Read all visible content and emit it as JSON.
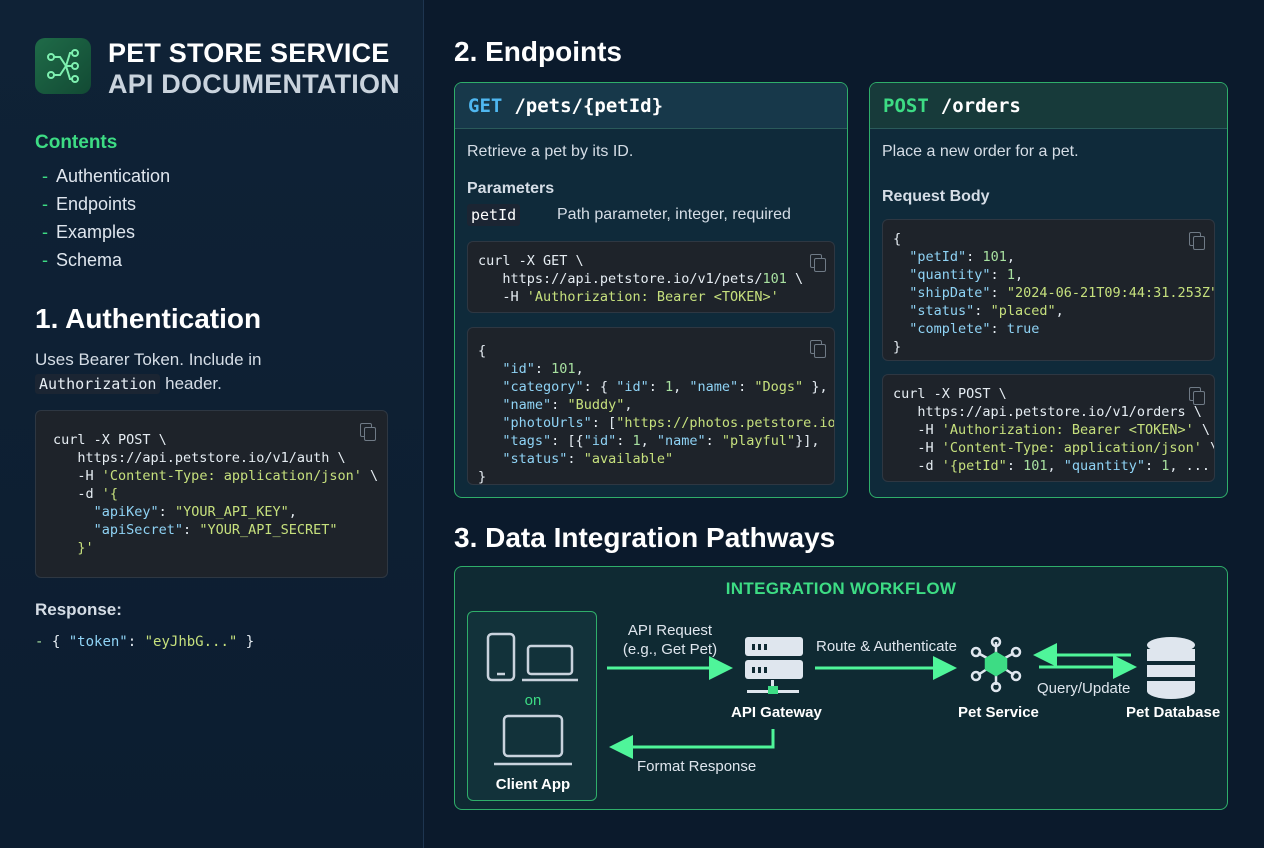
{
  "brand": {
    "title_line1": "PET STORE SERVICE",
    "title_line2": "API DOCUMENTATION",
    "logo_icon": "network-nodes-icon"
  },
  "contents": {
    "heading": "Contents",
    "items": [
      "Authentication",
      "Endpoints",
      "Examples",
      "Schema"
    ]
  },
  "auth": {
    "heading": "1. Authentication",
    "desc_prefix": "Uses Bearer Token. Include in",
    "desc_code": "Authorization",
    "desc_suffix": "header.",
    "response_heading": "Response:",
    "response_line": "- { \"token\": \"eyJhbG...\" }"
  },
  "endpoints": {
    "heading": "2. Endpoints",
    "get": {
      "method": "GET",
      "path": "/pets/{petId}",
      "desc": "Retrieve a pet by its ID.",
      "params_heading": "Parameters",
      "param_name": "petId",
      "param_desc": "Path parameter, integer, required"
    },
    "post": {
      "method": "POST",
      "path": "/orders",
      "desc": "Place a new order for a pet.",
      "body_heading": "Request Body"
    }
  },
  "integration": {
    "heading": "3. Data Integration Pathways",
    "title": "INTEGRATION WORKFLOW",
    "on": "on",
    "client_app": "Client App",
    "api_request_1": "API Request",
    "api_request_2": "(e.g., Get Pet)",
    "api_gateway": "API Gateway",
    "route_auth": "Route & Authenticate",
    "pet_service": "Pet Service",
    "query_update": "Query/Update",
    "pet_database": "Pet Database",
    "format_response": "Format Response"
  },
  "colors": {
    "accent_green": "#3ddc84",
    "get_blue": "#4fb7f0",
    "background": "#0b1a2c"
  }
}
